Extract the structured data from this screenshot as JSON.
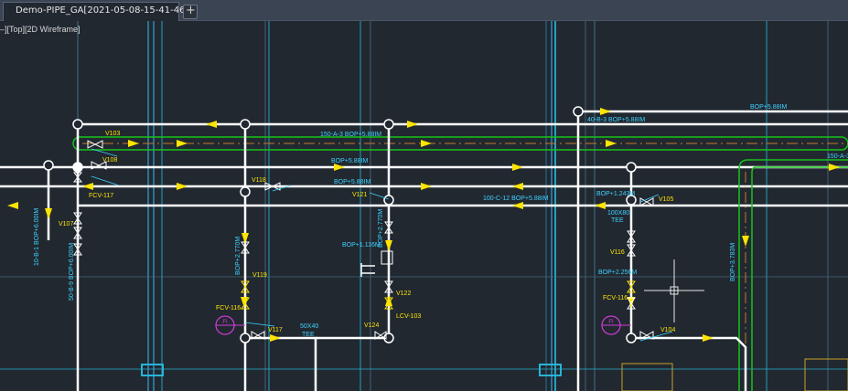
{
  "tabs": {
    "document_title": "Demo-PIPE_GA[2021-05-08-15-41-46]*",
    "new_tab_icon": "+"
  },
  "viewport_controls": {
    "prefix": "–]",
    "view": "[Top]",
    "style": "[2D Wireframe]"
  },
  "drawing": {
    "labels": {
      "line_150a3": "150-A-3 BOP+5.88IM",
      "bop_top_right": "BOP+5.88IM",
      "line_40b3": "40-B-3 BOP+5.88IM",
      "bop_mid_1": "BOP+5.88IM",
      "bop_mid_2": "BOP+5.88IM",
      "line_100c12": "100-C-12 BOP+5.88IM",
      "bop_1243": "BOP+1.243M",
      "line_150a_right": "150-A-3",
      "v103": "V103",
      "v108": "V108",
      "v118": "V118",
      "v121": "V121",
      "v107": "V107",
      "v119": "V119",
      "v117": "V117",
      "v124": "V124",
      "v122": "V122",
      "v105": "V105",
      "v116": "V116",
      "v104": "V104",
      "fcv117": "FCV-117",
      "fcv116": "FCV-116",
      "fcv116b": "FCV-116",
      "lcv103": "LCV-103",
      "line_10b1": "10-B-1 BOP+6.00IM",
      "line_50b9": "50-B-9 BOP+6.00IM",
      "bop_2770_left": "BOP+2.770M",
      "bop_2770_mid": "BOP+2.770M",
      "bop_1116": "BOP+1.116M",
      "bop_2256": "BOP+2.256M",
      "bop_3783": "BOP+3.783M",
      "size_50x40": "50X40",
      "tee_50x40": "TEE",
      "size_100x80": "100X80",
      "tee_100x80": "TEE",
      "fi_1": "FI",
      "fi_2": "FI"
    }
  },
  "colors": {
    "background": "#212830",
    "pipe": "#ffffff",
    "pipe_green": "#19c21a",
    "centerline_orange": "#c87a2a",
    "grid_blue": "#3e6f8c",
    "cyan": "#27b5d8",
    "arrow_yellow": "#ffe400",
    "label_cyan": "#3fd2ff",
    "instrument_magenta": "#d43ad8"
  }
}
